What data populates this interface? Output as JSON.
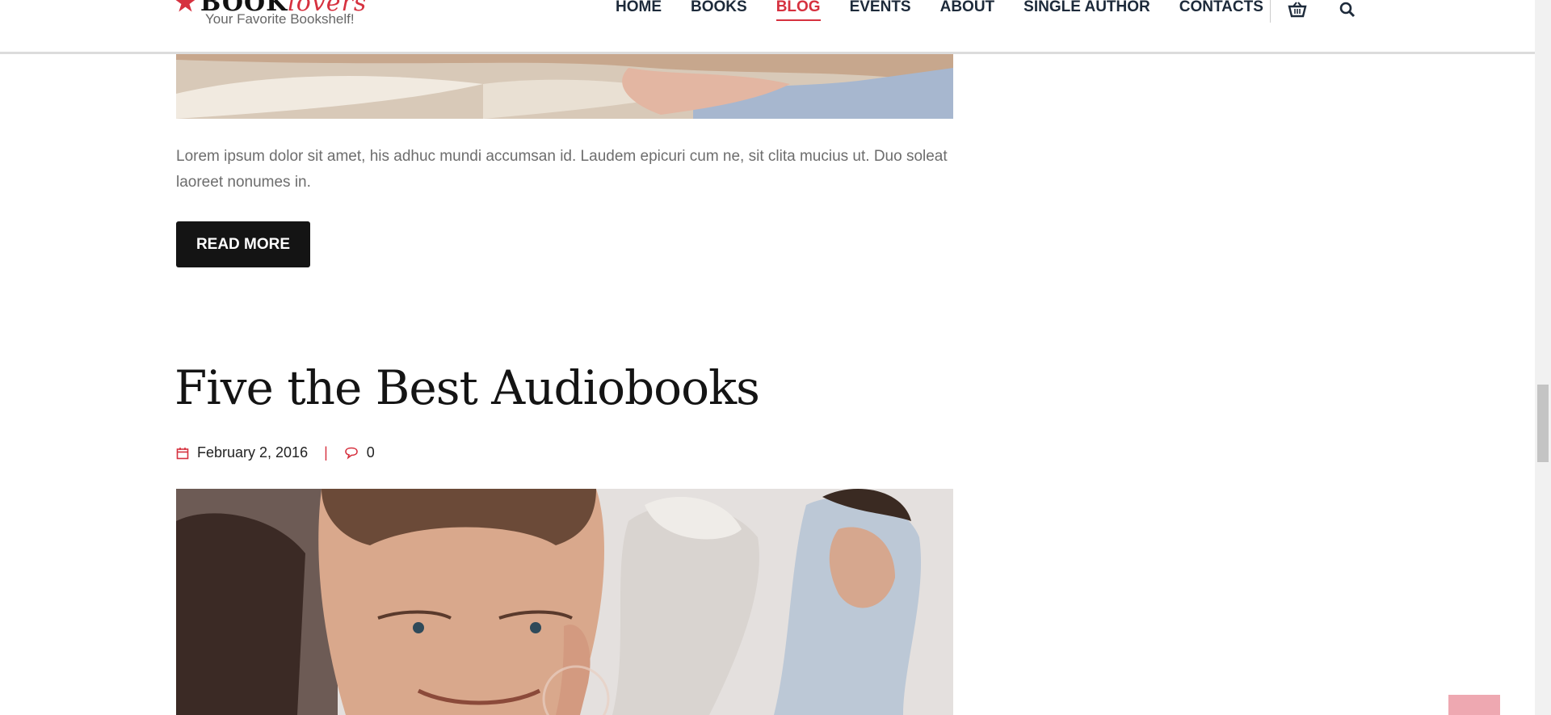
{
  "header": {
    "logo_text": "BOOK",
    "logo_text_accent": "lovers",
    "tagline": "Your Favorite Bookshelf!",
    "nav": [
      {
        "label": "HOME",
        "active": false
      },
      {
        "label": "BOOKS",
        "active": false
      },
      {
        "label": "BLOG",
        "active": true
      },
      {
        "label": "EVENTS",
        "active": false
      },
      {
        "label": "ABOUT",
        "active": false
      },
      {
        "label": "SINGLE AUTHOR",
        "active": false
      },
      {
        "label": "CONTACTS",
        "active": false
      }
    ],
    "icons": [
      "cart-icon",
      "search-icon"
    ]
  },
  "post_top": {
    "excerpt": "Lorem ipsum dolor sit amet, his adhuc mundi accumsan id. Laudem epicuri cum ne, sit clita mucius ut. Duo soleat laoreet nonumes in.",
    "read_more": "READ MORE"
  },
  "post": {
    "title": "Five the Best Audiobooks",
    "date": "February 2, 2016",
    "comments": "0"
  },
  "colors": {
    "accent": "#d6313f",
    "button": "#141414",
    "back_to_top": "#eea8b1"
  }
}
